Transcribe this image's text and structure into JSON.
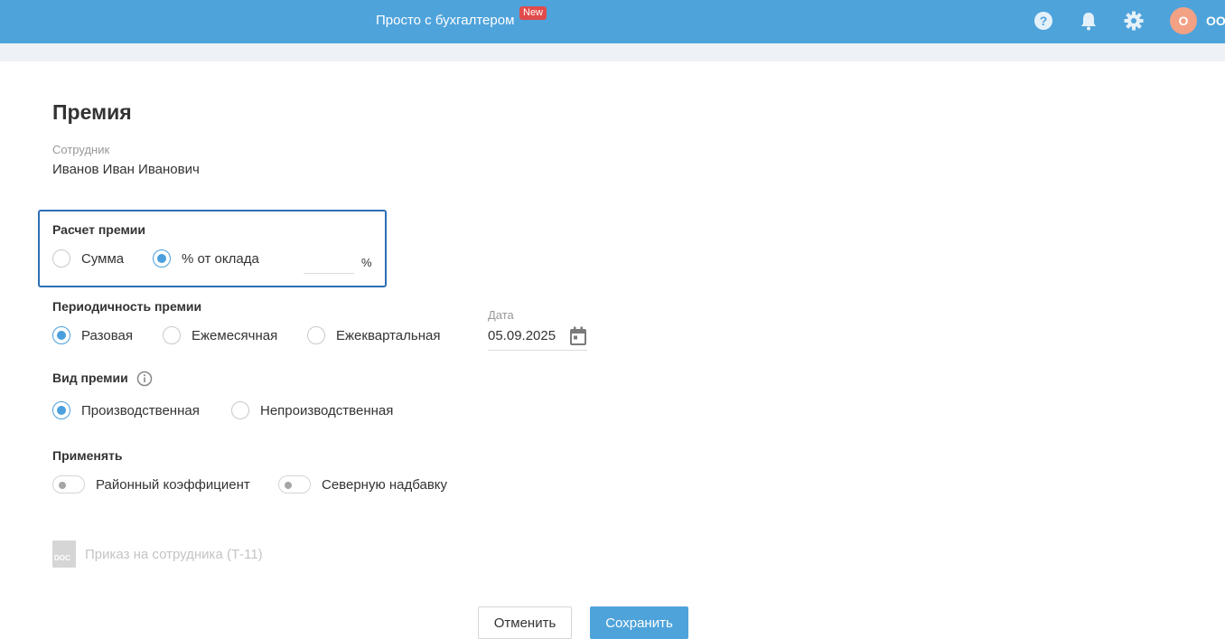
{
  "header": {
    "title": "Просто с бухгалтером",
    "badge": "New",
    "icons": [
      "help-icon",
      "bell-icon",
      "gear-icon"
    ],
    "avatar_letter": "О",
    "org_name": "ОО",
    "brand_color": "#4ea3db"
  },
  "page": {
    "title": "Премия",
    "employee_caption": "Сотрудник",
    "employee_name": "Иванов Иван Иванович"
  },
  "calculation": {
    "label": "Расчет премии",
    "options": [
      "Сумма",
      "% от оклада"
    ],
    "selected": "% от оклада",
    "percent_value": "",
    "percent_sign": "%"
  },
  "periodicity": {
    "label": "Периодичность премии",
    "options": [
      "Разовая",
      "Ежемесячная",
      "Ежеквартальная"
    ],
    "selected": "Разовая",
    "date_caption": "Дата",
    "date_value": "05.09.2025"
  },
  "bonus_type": {
    "label": "Вид премии",
    "options": [
      "Производственная",
      "Непроизводственная"
    ],
    "selected": "Производственная"
  },
  "apply": {
    "label": "Применять",
    "toggles": [
      {
        "label": "Районный коэффициент",
        "on": false
      },
      {
        "label": "Северную надбавку",
        "on": false
      }
    ]
  },
  "document": {
    "icon_text": "DOC",
    "label": "Приказ на сотрудника (Т-11)"
  },
  "actions": {
    "cancel": "Отменить",
    "save": "Сохранить"
  }
}
